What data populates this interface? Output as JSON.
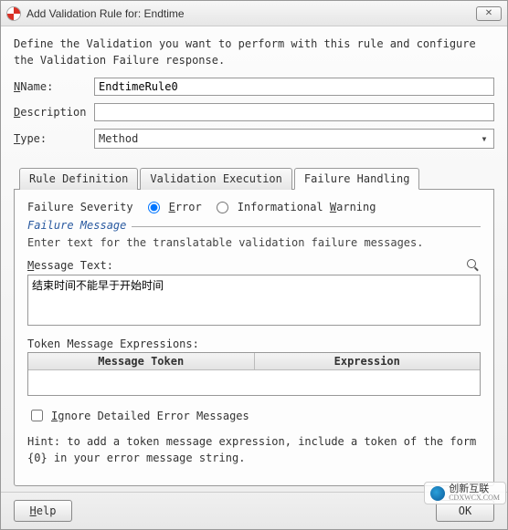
{
  "window": {
    "title": "Add Validation Rule for: Endtime",
    "close": "✕"
  },
  "intro": "Define the Validation you want to perform with this rule and configure the Validation Failure response.",
  "form": {
    "name_label": "Name:",
    "name_key": "N",
    "name_value": "EndtimeRule0",
    "desc_label": "escription",
    "desc_key": "D",
    "desc_value": "",
    "type_label": "ype:",
    "type_key": "T",
    "type_value": "Method"
  },
  "tabs": {
    "items": [
      {
        "label": "Rule Definition"
      },
      {
        "label": "Validation Execution"
      },
      {
        "label": "Failure Handling"
      }
    ],
    "active": 2
  },
  "failure": {
    "severity_label": "Failure Severity",
    "error_label": "rror",
    "error_key": "E",
    "warning_label": "Informational ",
    "warning_key": "W",
    "warning_suffix": "arning",
    "selected": "error",
    "legend": "Failure Message",
    "instruction": "Enter text for the translatable validation failure messages.",
    "msg_label": "essage Text:",
    "msg_key": "M",
    "msg_value": "结束时间不能早于开始时间",
    "token_label": "Token Message Expressions:",
    "token_col1": "Message Token",
    "token_col2": "Expression",
    "ignore_label": "gnore Detailed Error Messages",
    "ignore_key": "I",
    "hint": "Hint: to add a token message expression, include a token of the form {0} in your error message string."
  },
  "footer": {
    "help": "elp",
    "help_key": "H",
    "ok": "OK"
  },
  "watermark": {
    "line1": "创新互联",
    "line2": "CDXWCX.COM"
  }
}
